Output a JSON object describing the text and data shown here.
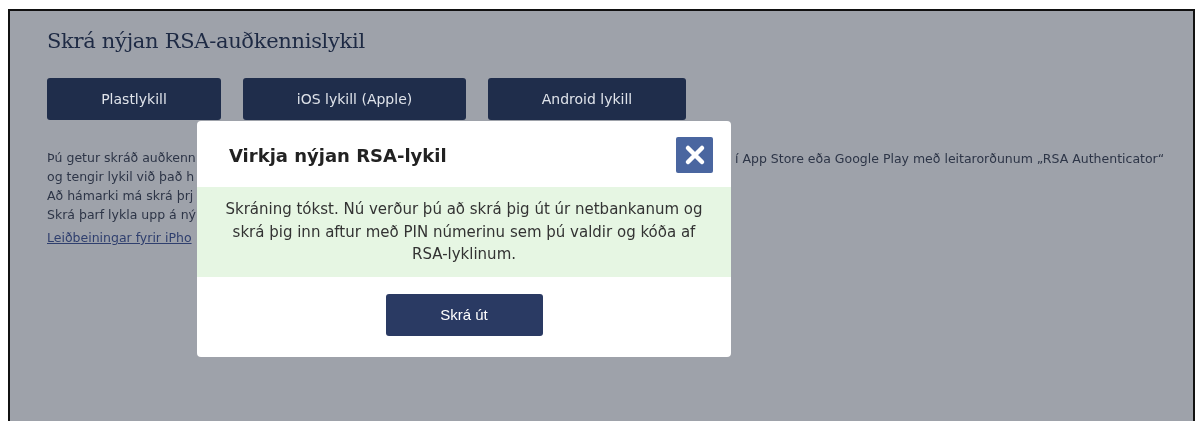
{
  "page": {
    "title": "Skrá nýjan RSA-auðkennislykil",
    "key_types": [
      {
        "label": "Plastlykill"
      },
      {
        "label": "iOS lykill (Apple)"
      },
      {
        "label": "Android lykill"
      }
    ],
    "intro_lines_left": [
      "Þú getur skráð auðkenn",
      "og tengir lykil við það h",
      "Að hámarki má skrá þrj",
      "Skrá þarf lykla upp á ný"
    ],
    "intro_line_right": "í App Store eða Google Play með leitarorðunum „RSA Authenticator“",
    "guide_link": "Leiðbeiningar fyrir iPho"
  },
  "dialog": {
    "title": "Virkja nýjan RSA-lykil",
    "message": "Skráning tókst. Nú verður þú að skrá þig út úr netbankanum og skrá þig inn aftur með PIN númerinu sem þú valdir og kóða af RSA-lyklinum.",
    "button": "Skrá út"
  }
}
